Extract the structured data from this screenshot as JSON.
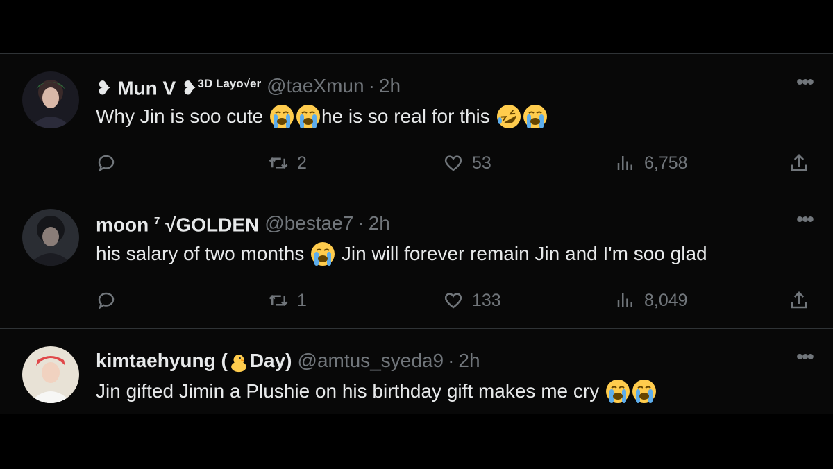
{
  "tweets": [
    {
      "name_prefix": "Mun V",
      "name_badge": "3D Layo",
      "name_tail": "er",
      "handle": "@taeXmun",
      "time": "2h",
      "text_1": "Why Jin is soo cute",
      "text_2": "he is so real for this",
      "replies": "",
      "retweets": "2",
      "likes": "53",
      "views": "6,758"
    },
    {
      "name_prefix": "moon",
      "name_sup": "7",
      "name_tail": "GOLDEN",
      "handle": "@bestae7",
      "time": "2h",
      "text_1": "his salary of two months",
      "text_2": "Jin will forever remain Jin and I'm soo glad",
      "retweets": "1",
      "likes": "133",
      "views": "8,049"
    },
    {
      "name_prefix": "kimtaehyung (",
      "name_tail": "Day)",
      "handle": "@amtus_syeda9",
      "time": "2h",
      "text_1": "Jin gifted Jimin a Plushie on his birthday gift makes me cry"
    }
  ],
  "icons": {
    "reply": "reply-icon",
    "retweet": "retweet-icon",
    "like": "heart-icon",
    "views": "views-icon",
    "share": "share-icon",
    "more": "more-icon",
    "crying": "loudly-crying-emoji",
    "laughing": "rolling-laughing-emoji",
    "chick": "chick-emoji"
  },
  "colors": {
    "background": "#000000",
    "text": "#e7e9ea",
    "muted": "#71767b",
    "divider": "#2f3336",
    "emoji_yellow": "#ffcc4d"
  }
}
